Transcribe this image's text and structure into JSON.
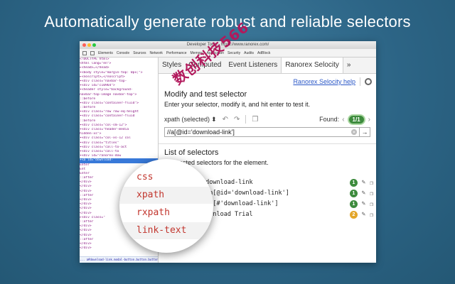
{
  "headline": "Automatically generate robust and reliable selectors",
  "window": {
    "title": "Developer Tools - https://www.ranorex.com/",
    "devtools_tabs": [
      "Elements",
      "Console",
      "Sources",
      "Network",
      "Performance",
      "Memory",
      "Application",
      "Security",
      "Audits",
      "AdBlock"
    ]
  },
  "elements_panel": {
    "lines": [
      "<!DOCTYPE html>",
      "<html lang=\"en\">",
      "▸<head>…</head>",
      "▾<body style=\"margin-top: 0px;\">",
      "  ▸<noscript>…</noscript>",
      "  ▾<div class=\"navbar-top-",
      "    ▾<div id=\"c10964\">",
      "      ▾<header style=\"background-",
      "       navbar-top-image navbar-top\">",
      "        ::before",
      "        ▾<div class=\"container-fluid\">",
      "          ::before",
      "          ▾<div class=\"row row-eq-height",
      "            ▾<div class=\"container-fluid",
      "              ::before",
      "              ▾<div class=\"col-sm-12\">",
      "                ▾<div class=\"header-media",
      "                 hidden-xs\">",
      "                  ▾<div class=\"col-xs-12 col",
      "                    ▾<div class=\"titles\"",
      "                      ▾<div class=\"call-to-act",
      "                        ▾<div class=\"call-to",
      "                          ▾<div id=\"ranorex-dow",
      "                            ▾<a id=\"download-",
      "                             Enter",
      "                             Ent",
      "                             Enter",
      "                             ::after",
      "                            </div>",
      "                          </div>",
      "                        </div>",
      "                      ::after",
      "                    </div>",
      "                  </div>",
      "                </div>",
      "              </div>",
      "            ▸<div class=\"",
      "              ::after",
      "            </div>",
      "          </div>",
      "        </div>",
      "      ::after",
      "    </div>",
      "  </div>"
    ],
    "selected_index": 23,
    "status_bar": "...  a#download-link.modal-button.button.button-accent.download-button"
  },
  "panel_tabs": [
    "Styles",
    "Computed",
    "Event Listeners",
    "Ranorex Selocity",
    "»"
  ],
  "help_link": "Ranorex Selocity help",
  "modify": {
    "title": "Modify and test selector",
    "desc": "Enter your selector, modify it, and hit enter to test it.",
    "type_selected": "xpath (selected)",
    "found_label": "Found:",
    "found_count": "1/1",
    "input_value": "//a[@id='download-link']"
  },
  "list": {
    "title": "List of selectors",
    "desc": "Suggested selectors for the element.",
    "items": [
      {
        "type": "css",
        "value": "#download-link",
        "count": "1",
        "color": "#3d8b3d"
      },
      {
        "type": "xpath",
        "value": "//a[@id='download-link']",
        "count": "1",
        "color": "#3d8b3d"
      },
      {
        "type": "rxpath",
        "value": "//a[#'download-link']",
        "count": "1",
        "color": "#3d8b3d"
      },
      {
        "type": "link-text",
        "value": "Download Trial",
        "count": "2",
        "color": "#e3a62a"
      }
    ]
  },
  "magnifier_items": [
    "css",
    "xpath",
    "rxpath",
    "link-text"
  ],
  "watermark": "数创科技566"
}
